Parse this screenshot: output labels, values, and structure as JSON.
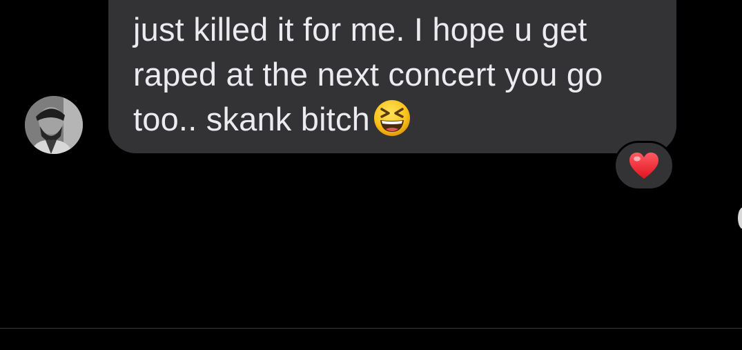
{
  "message": {
    "lines": [
      "just killed it for me.  I hope u get",
      "raped at the next concert you go",
      "too.. skank bitch"
    ],
    "emoji": "grinning-squinting-face-icon",
    "bubble_color": "#333336",
    "text_color": "#ececf0"
  },
  "reaction": {
    "emoji": "red-heart-icon",
    "color": "#ff2d3d"
  },
  "sender": {
    "avatar": "avatar-photo"
  },
  "colors": {
    "background": "#000000",
    "divider": "#3a3a3c"
  }
}
